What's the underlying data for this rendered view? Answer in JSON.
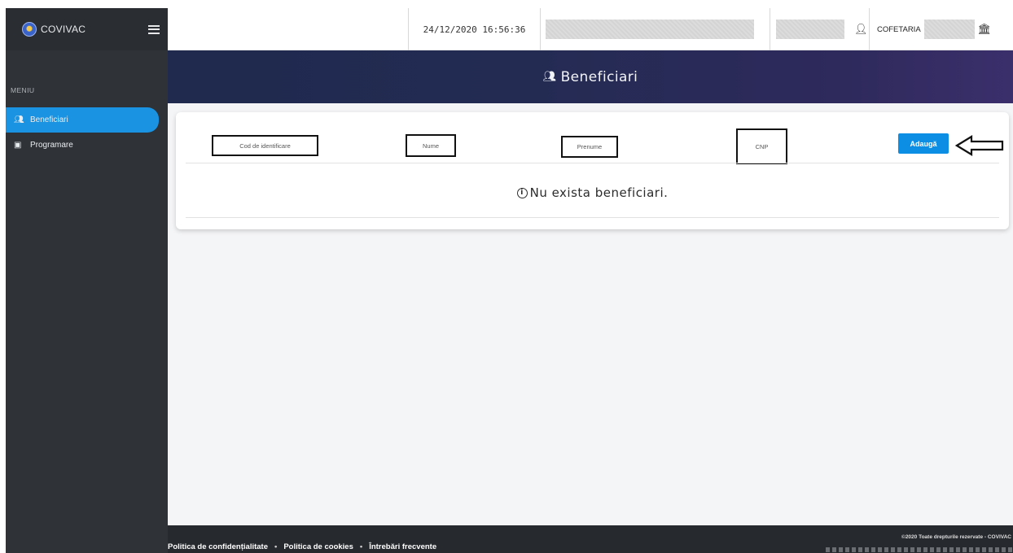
{
  "app": {
    "name": "COVIVAC"
  },
  "sidebar": {
    "menu_title": "MENIU",
    "items": [
      {
        "label": "Beneficiari",
        "icon": "users-icon",
        "active": true
      },
      {
        "label": "Programare",
        "icon": "calendar-icon",
        "active": false
      }
    ]
  },
  "topbar": {
    "datetime": "24/12/2020 16:56:36",
    "org_label": "COFETARIA"
  },
  "page": {
    "title": "Beneficiari",
    "empty_message": "Nu exista beneficiari."
  },
  "filters": {
    "cod_placeholder": "Cod de identificare",
    "nume_placeholder": "Nume",
    "prenume_placeholder": "Prenume",
    "cnp_placeholder": "CNP"
  },
  "actions": {
    "add_label": "Adaugă"
  },
  "footer": {
    "links": [
      "Politica de confidențialitate",
      "Politica de cookies",
      "Întrebări frecvente"
    ],
    "copyright": "©2020 Toate drepturile rezervate - COVIVAC"
  },
  "colors": {
    "sidebar_bg": "#2f3338",
    "active_item": "#1a93e3",
    "banner_start": "#1f2a4e",
    "banner_end": "#3b2f6b",
    "primary_button": "#0b8ee4",
    "footer_bg": "#26292e"
  }
}
